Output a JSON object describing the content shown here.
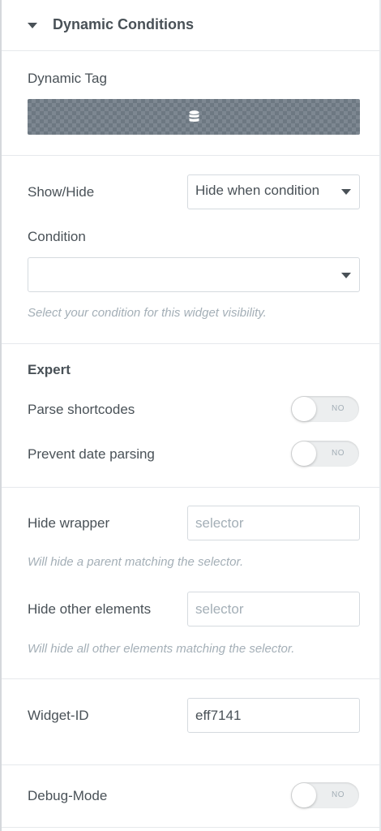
{
  "section": {
    "title": "Dynamic Conditions",
    "expanded": true
  },
  "dynamic_tag": {
    "label": "Dynamic Tag",
    "icon": "database-icon",
    "bar_color": "#6d7882"
  },
  "show_hide": {
    "label": "Show/Hide",
    "value": "Hide when condition"
  },
  "condition": {
    "label": "Condition",
    "value": "",
    "help": "Select your condition for this widget visibility."
  },
  "expert": {
    "heading": "Expert",
    "parse_shortcodes": {
      "label": "Parse shortcodes",
      "toggle": "NO"
    },
    "prevent_date_parsing": {
      "label": "Prevent date parsing",
      "toggle": "NO"
    }
  },
  "hide_wrapper": {
    "label": "Hide wrapper",
    "placeholder": "selector",
    "value": "",
    "help": "Will hide a parent matching the selector."
  },
  "hide_other": {
    "label": "Hide other elements",
    "placeholder": "selector",
    "value": "",
    "help": "Will hide all other elements matching the selector."
  },
  "widget_id": {
    "label": "Widget-ID",
    "value": "eff7141"
  },
  "debug_mode": {
    "label": "Debug-Mode",
    "toggle": "NO"
  },
  "colors": {
    "text": "#495157",
    "muted": "#a4afb7",
    "border": "#d5dadf",
    "divider": "#e6e9ec"
  }
}
